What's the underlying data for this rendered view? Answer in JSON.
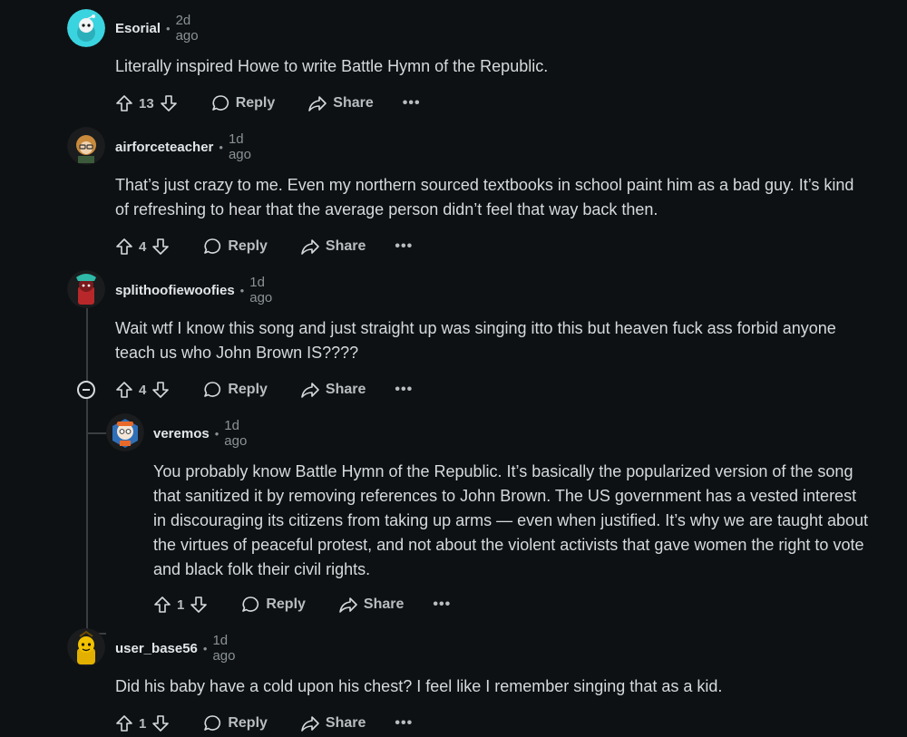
{
  "labels": {
    "reply": "Reply",
    "share": "Share",
    "more": "•••"
  },
  "comments": [
    {
      "author": "Esorial",
      "time": "2d ago",
      "text": "Literally inspired Howe to write Battle Hymn of the Republic.",
      "votes": "13",
      "avatar_color": "#3ad4e0"
    },
    {
      "author": "airforceteacher",
      "time": "1d ago",
      "text": "That’s just crazy to me. Even my northern sourced textbooks in school paint him as a bad guy. It’s kind of refreshing to hear that the average person didn’t feel that way back then.",
      "votes": "4",
      "avatar_color": "#c98a3c"
    },
    {
      "author": "splithoofiewoofies",
      "time": "1d ago",
      "text": "Wait wtf I know this song and just straight up was singing itto this but heaven fuck ass forbid anyone teach us who John Brown IS????",
      "votes": "4",
      "avatar_color": "#b8282a"
    },
    {
      "author": "veremos",
      "time": "1d ago",
      "text": "You probably know Battle Hymn of the Republic. It’s basically the popularized version of the song that sanitized it by removing references to John Brown. The US government has a vested interest in discouraging its citizens from taking up arms — even when justified. It’s why we are taught about the virtues of peaceful protest, and not about the violent activists that gave women the right to vote and black folk their civil rights.",
      "votes": "1",
      "avatar_color": "#2f6fb8"
    },
    {
      "author": "user_base56",
      "time": "1d ago",
      "text": "Did his baby have a cold upon his chest? I feel like I remember singing that as a kid.",
      "votes": "1",
      "avatar_color": "#e3b000"
    }
  ]
}
